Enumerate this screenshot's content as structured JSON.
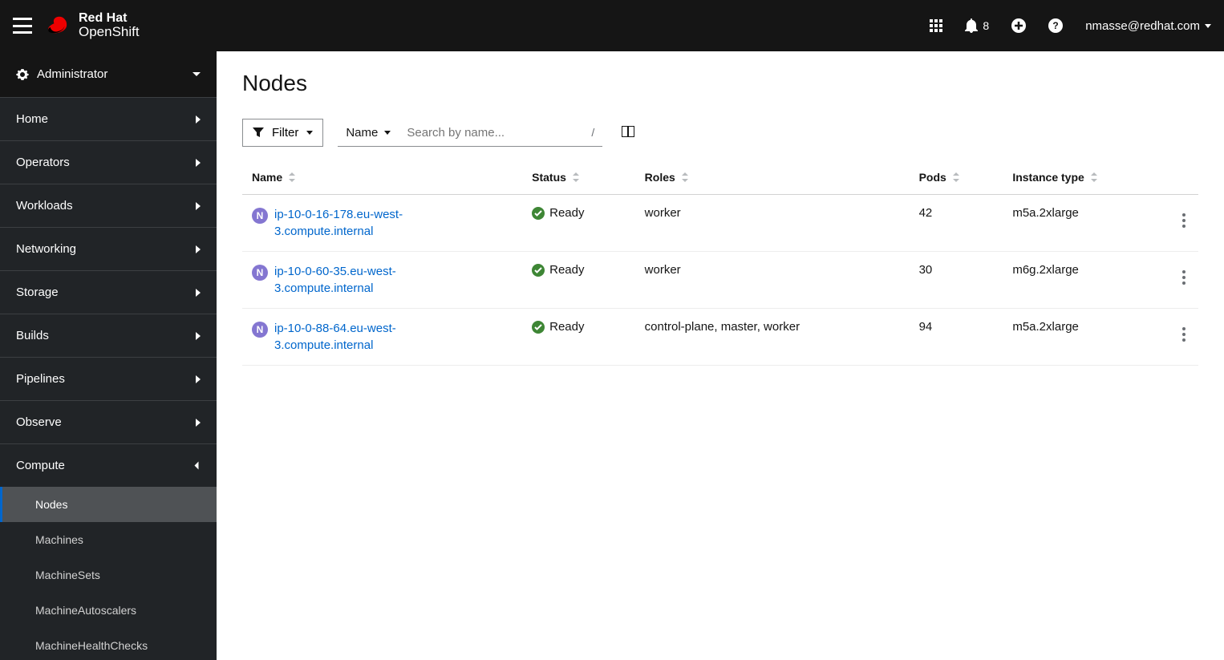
{
  "header": {
    "brand": "Red Hat",
    "product": "OpenShift",
    "notification_count": "8",
    "user": "nmasse@redhat.com"
  },
  "sidebar": {
    "perspective": "Administrator",
    "items": [
      {
        "label": "Home",
        "expanded": false
      },
      {
        "label": "Operators",
        "expanded": false
      },
      {
        "label": "Workloads",
        "expanded": false
      },
      {
        "label": "Networking",
        "expanded": false
      },
      {
        "label": "Storage",
        "expanded": false
      },
      {
        "label": "Builds",
        "expanded": false
      },
      {
        "label": "Pipelines",
        "expanded": false
      },
      {
        "label": "Observe",
        "expanded": false
      },
      {
        "label": "Compute",
        "expanded": true
      }
    ],
    "compute_sub": [
      {
        "label": "Nodes",
        "active": true
      },
      {
        "label": "Machines",
        "active": false
      },
      {
        "label": "MachineSets",
        "active": false
      },
      {
        "label": "MachineAutoscalers",
        "active": false
      },
      {
        "label": "MachineHealthChecks",
        "active": false
      }
    ]
  },
  "main": {
    "title": "Nodes",
    "toolbar": {
      "filter_label": "Filter",
      "attr_label": "Name",
      "search_placeholder": "Search by name...",
      "search_divider": "/"
    },
    "columns": [
      "Name",
      "Status",
      "Roles",
      "Pods",
      "Instance type"
    ],
    "rows": [
      {
        "name": "ip-10-0-16-178.eu-west-3.compute.internal",
        "status": "Ready",
        "roles": "worker",
        "pods": "42",
        "instance": "m5a.2xlarge"
      },
      {
        "name": "ip-10-0-60-35.eu-west-3.compute.internal",
        "status": "Ready",
        "roles": "worker",
        "pods": "30",
        "instance": "m6g.2xlarge"
      },
      {
        "name": "ip-10-0-88-64.eu-west-3.compute.internal",
        "status": "Ready",
        "roles": "control-plane, master, worker",
        "pods": "94",
        "instance": "m5a.2xlarge"
      }
    ],
    "node_badge": "N"
  }
}
